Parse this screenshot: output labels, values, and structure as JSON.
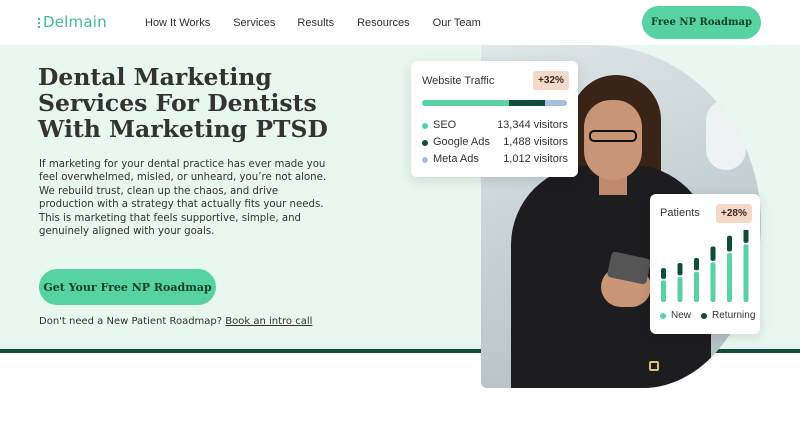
{
  "nav": {
    "logo": "Delmain",
    "links": [
      "How It Works",
      "Services",
      "Results",
      "Resources",
      "Our Team"
    ],
    "cta": "Free NP Roadmap"
  },
  "hero": {
    "headline": "Dental Marketing Services For Dentists With Marketing PTSD",
    "description": "If marketing for your dental practice has ever made you feel overwhelmed, misled, or unheard, you’re not alone. We rebuild trust, clean up the chaos, and drive production with a strategy that actually fits your needs. This is marketing that feels supportive, simple, and genuinely aligned with your goals.",
    "cta": "Get Your Free NP Roadmap",
    "intro_prefix": "Don't need a New Patient Roadmap?",
    "intro_link": "Book an intro call"
  },
  "traffic_card": {
    "title": "Website Traffic",
    "badge": "+32%",
    "shares": [
      0.6,
      0.25,
      0.15
    ],
    "rows": [
      {
        "name": "SEO",
        "value": "13,344 visitors"
      },
      {
        "name": "Google Ads",
        "value": "1,488 visitors"
      },
      {
        "name": "Meta Ads",
        "value": "1,012 visitors"
      }
    ]
  },
  "patients_card": {
    "title": "Patients",
    "badge": "+28%",
    "legend": [
      "New",
      "Returning"
    ],
    "bars": [
      {
        "new": 0.3,
        "returning": 0.15
      },
      {
        "new": 0.35,
        "returning": 0.17
      },
      {
        "new": 0.42,
        "returning": 0.17
      },
      {
        "new": 0.55,
        "returning": 0.2
      },
      {
        "new": 0.68,
        "returning": 0.22
      },
      {
        "new": 0.8,
        "returning": 0.26
      }
    ]
  },
  "colors": {
    "accent": "#56d3a0",
    "dark_green": "#0f4e3c",
    "light_blue": "#a9bddc",
    "hero_bg": "#e8f8f0",
    "badge_bg": "#f4d9c6"
  }
}
